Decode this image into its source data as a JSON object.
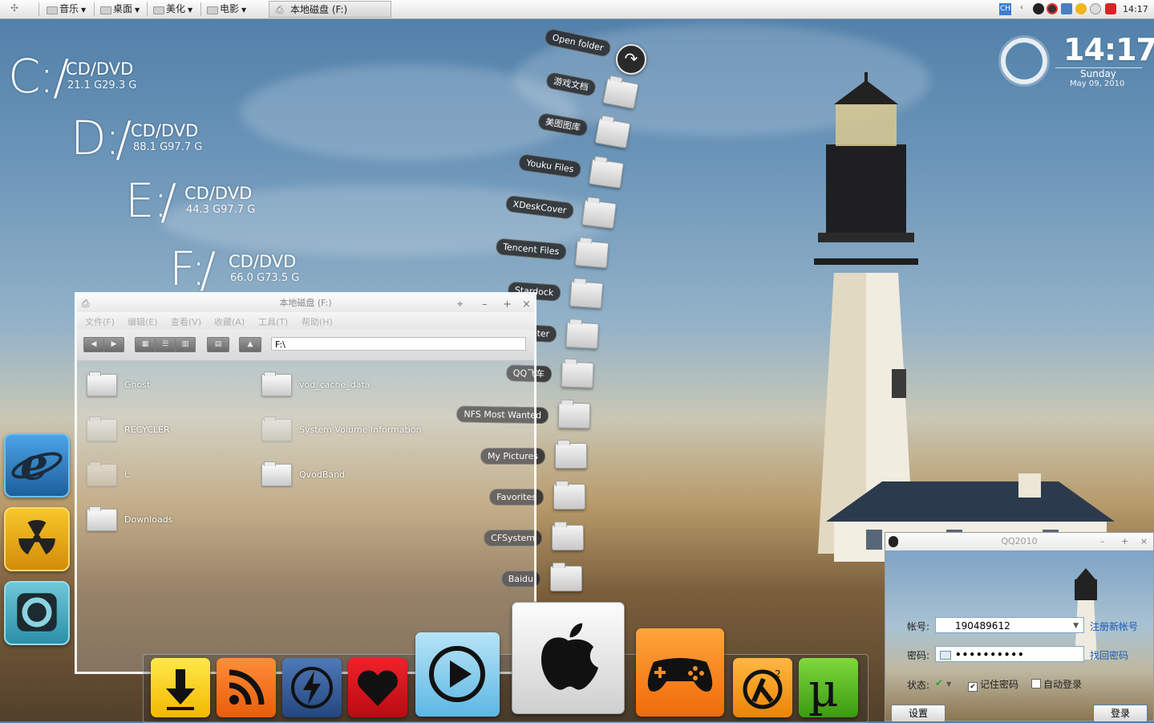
{
  "taskbar": {
    "items": [
      "音乐",
      "桌面",
      "美化",
      "电影"
    ],
    "active_window": "本地磁盘 (F:)",
    "input_lang": "CH",
    "time": "14:17"
  },
  "drives": [
    {
      "letter": "C:",
      "kind": "CD/DVD",
      "size": "21.1 G29.3 G"
    },
    {
      "letter": "D:",
      "kind": "CD/DVD",
      "size": "88.1 G97.7 G"
    },
    {
      "letter": "E:",
      "kind": "CD/DVD",
      "size": "44.3 G97.7 G"
    },
    {
      "letter": "F:",
      "kind": "CD/DVD",
      "size": "66.0 G73.5 G"
    }
  ],
  "clock_widget": {
    "time": "14:17",
    "day": "Sunday",
    "date": "May 09, 2010"
  },
  "stack": {
    "open_label": "Open folder",
    "folders": [
      "游戏文档",
      "美图图库",
      "Youku Files",
      "XDeskCover",
      "Tencent Files",
      "Stardock",
      "Rainmeter",
      "QQ飞车",
      "NFS Most Wanted",
      "My Pictures",
      "Favorites",
      "CFSystem",
      "Baidu"
    ]
  },
  "explorer": {
    "title": "本地磁盘 (F:)",
    "menu": [
      "文件(F)",
      "编辑(E)",
      "查看(V)",
      "收藏(A)",
      "工具(T)",
      "帮助(H)"
    ],
    "address": "F:\\",
    "items": [
      {
        "name": "Ghost",
        "faded": false
      },
      {
        "name": "vod_cache_data",
        "faded": false
      },
      {
        "name": "RECYCLER",
        "faded": true
      },
      {
        "name": "System Volume Information",
        "faded": true
      },
      {
        "name": "ـا",
        "faded": true
      },
      {
        "name": "QvodBand",
        "faded": false
      },
      {
        "name": "Downloads",
        "faded": false
      }
    ]
  },
  "qq": {
    "title": "QQ2010",
    "account_label": "帐号:",
    "account_value": "190489612",
    "register_link": "注册新帐号",
    "password_label": "密码:",
    "password_value": "••••••••••",
    "forgot_link": "找回密码",
    "status_label": "状态:",
    "remember_label": "记住密码",
    "auto_login_label": "自动登录",
    "settings_button": "设置",
    "login_button": "登录"
  },
  "dock": [
    "download-icon",
    "rss-icon",
    "flash-icon",
    "heart-icon",
    "media-player-icon",
    "apple-icon",
    "gamepad-icon",
    "half-life-icon",
    "utorrent-icon"
  ],
  "launcher": [
    "internet-explorer-icon",
    "radiation-icon",
    "camera-icon"
  ]
}
